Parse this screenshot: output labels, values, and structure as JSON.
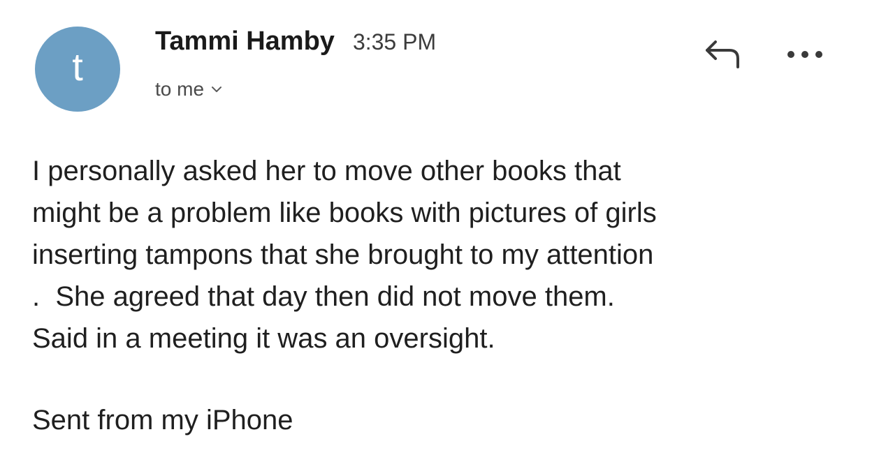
{
  "header": {
    "avatar_letter": "t",
    "sender_name": "Tammi Hamby",
    "sent_time": "3:35 PM",
    "recipient_label": "to me",
    "icons": {
      "reply": "reply-icon",
      "more": "more-options-icon",
      "recipient_toggle": "chevron-down-icon"
    },
    "avatar_color": "#6c9fc4"
  },
  "message": {
    "body_lines": [
      "I personally asked her to move other books that",
      "might be a problem like books with pictures of girls",
      "inserting tampons that she brought to my attention",
      ".  She agreed that day then did not move them.",
      "Said in a meeting it was an oversight."
    ],
    "signature": "Sent from my iPhone"
  }
}
